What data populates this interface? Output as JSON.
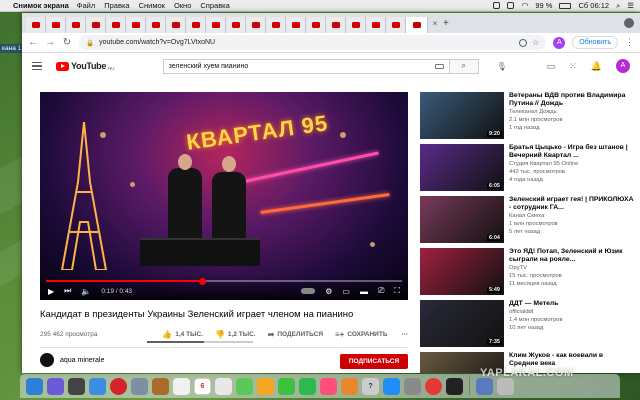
{
  "menubar": {
    "app_name": "Снимок экрана",
    "items": [
      "Файл",
      "Правка",
      "Снимок",
      "Окно",
      "Справка"
    ],
    "battery": "99 %",
    "clock": "Сб 06:12"
  },
  "desktop": {
    "label": "кана 1"
  },
  "browser": {
    "url": "youtube.com/watch?v=Ovg7LVtxoNU",
    "profile_initial": "A",
    "update_label": "Обновить"
  },
  "youtube": {
    "logo_text": "YouTube",
    "logo_region": "RU",
    "search_value": "зеленский хуем пианино",
    "avatar_initial": "A"
  },
  "player": {
    "time": "0:19 / 0:43",
    "progress_fraction": 0.44,
    "stage_sign": "КВАРТАЛ 95"
  },
  "video": {
    "title": "Кандидат в президенты Украины Зеленский играет членом на пианино",
    "views": "295 462 просмотра",
    "likes": "1,4 ТЫС.",
    "dislikes": "1,2 ТЫС.",
    "share_label": "ПОДЕЛИТЬСЯ",
    "save_label": "СОХРАНИТЬ",
    "like_ratio": 0.54,
    "channel_name": "aqua minerale",
    "subscribe_label": "ПОДПИСАТЬСЯ"
  },
  "recommendations": [
    {
      "title": "Ветераны ВДВ против Владимира Путина // Дождь",
      "channel": "Телеканал Дождь",
      "views": "2,1 млн просмотров",
      "age": "1 год назад",
      "duration": "9:20",
      "color": "#3b5a7a"
    },
    {
      "title": "Братья Цыцько - Игра без штанов | Вечерний Квартал ...",
      "channel": "Студия Квартал 95 Online",
      "views": "442 тыс. просмотров",
      "age": "4 года назад",
      "duration": "6:05",
      "color": "#5a2a8a"
    },
    {
      "title": "Зеленский играет гея! | ПРИКОЛЮХА - сотрудник ГА...",
      "channel": "Канал Смеха",
      "views": "1 млн просмотров",
      "age": "5 лет назад",
      "duration": "6:04",
      "color": "#7a3a5a"
    },
    {
      "title": "Это ЯД! Потап, Зеленский и Юзик сыграли на рояле...",
      "channel": "OpyTV",
      "views": "15 тыс. просмотров",
      "age": "11 месяцев назад",
      "duration": "5:49",
      "color": "#a02040"
    },
    {
      "title": "ДДТ — Метель",
      "channel": "officialddt",
      "views": "1,4 млн просмотров",
      "age": "10 лет назад",
      "duration": "7:35",
      "color": "#2a2a3a"
    },
    {
      "title": "Клим Жуков - как воевали в Средние века",
      "channel": "",
      "views": "",
      "age": "",
      "duration": "",
      "color": "#6a5a40"
    }
  ],
  "watermark": "YAPLAKAL.COM"
}
